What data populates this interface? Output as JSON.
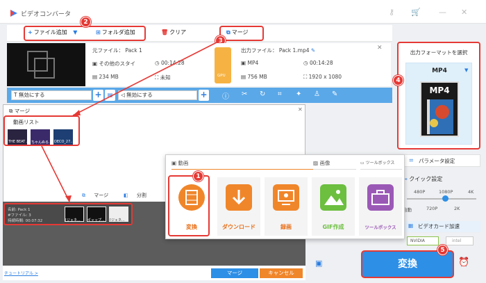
{
  "app": {
    "title": "ビデオコンバータ"
  },
  "toolbar": {
    "add_file": "ファイル追加",
    "add_folder": "フォルダ追加",
    "clear": "クリア",
    "merge": "マージ"
  },
  "file": {
    "source_label": "元ファイル：",
    "source_name": "Pack 1",
    "source_format": "その他のスタイ",
    "source_duration": "00:14:28",
    "source_size": "234 MB",
    "source_resolution": "未知",
    "output_label": "出力ファイル：",
    "output_name": "Pack 1.mp4",
    "output_format": "MP4",
    "output_duration": "00:14:28",
    "output_size": "756 MB",
    "output_resolution": "1920 x 1080",
    "gpu_label": "GPU"
  },
  "settings": {
    "subtitle_select": "無効にする",
    "audio_select": "無効にする"
  },
  "format_panel": {
    "heading": "出力フォーマットを選択",
    "format": "MP4",
    "icon_text": "MP4"
  },
  "side": {
    "param_settings": "パラメータ設定",
    "quick_settings": "クイック設定",
    "slider_top": [
      "480P",
      "1080P",
      "4K"
    ],
    "slider_bottom": [
      "自動",
      "720P",
      "2K"
    ],
    "gpu_accel": "ビデオカード加速",
    "nvidia": "NVIDIA",
    "intel": "intel",
    "convert": "変換"
  },
  "merge_dialog": {
    "title": "マージ",
    "video_list": "動画リスト",
    "thumbs": [
      "THE BEAT ...",
      "ちゃんぬる...",
      "DECO_27..."
    ],
    "merge_tab": "マージ",
    "split_tab": "分割",
    "pack_name": "名前: Pack 1",
    "pack_count": "#ファイル: 3",
    "pack_time": "持続時間: 00:07:32",
    "pack_thumbs": [
      "[ジェネ...",
      "ギャップ...",
      "[ジェネ..."
    ],
    "tutorial": "チュートリアル >",
    "merge_btn": "マージ",
    "cancel_btn": "キャンセル"
  },
  "toolbox": {
    "cat_video": "動画",
    "cat_image": "画像",
    "cat_tools": "ツールボックス",
    "tools": [
      "変換",
      "ダウンロード",
      "録画",
      "GIF作成",
      "ツールボックス"
    ]
  },
  "badges": [
    "1",
    "2",
    "3",
    "4",
    "5"
  ],
  "colors": {
    "accent": "#2d8fe6",
    "orange": "#f0862a",
    "highlight": "#e53935"
  }
}
